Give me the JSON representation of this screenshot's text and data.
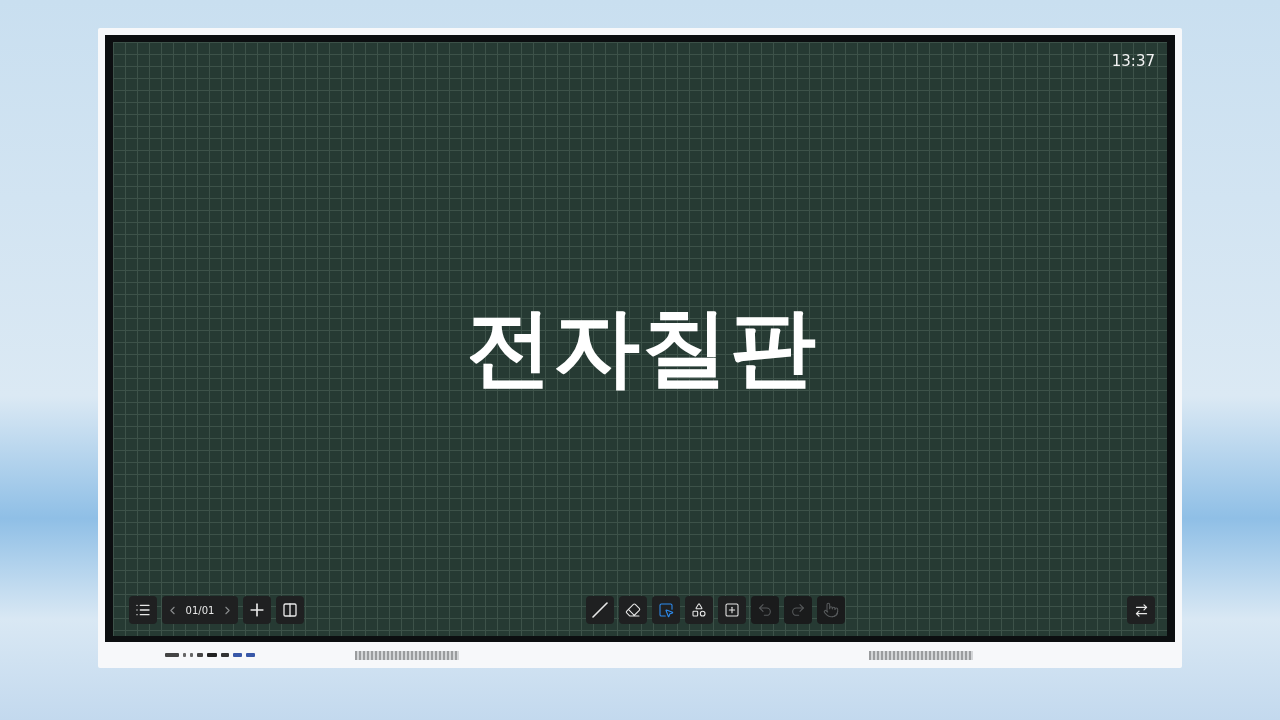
{
  "clock": "13:37",
  "title": "전자칠판",
  "page_nav": {
    "label": "01/01"
  },
  "tools": [
    {
      "kind": "pen",
      "selected": false,
      "disabled": false
    },
    {
      "kind": "eraser",
      "selected": false,
      "disabled": false
    },
    {
      "kind": "select",
      "selected": true,
      "disabled": false
    },
    {
      "kind": "shapes",
      "selected": false,
      "disabled": false
    },
    {
      "kind": "insert",
      "selected": false,
      "disabled": false
    },
    {
      "kind": "undo",
      "selected": false,
      "disabled": true
    },
    {
      "kind": "redo",
      "selected": false,
      "disabled": true
    },
    {
      "kind": "gesture",
      "selected": false,
      "disabled": true
    }
  ]
}
